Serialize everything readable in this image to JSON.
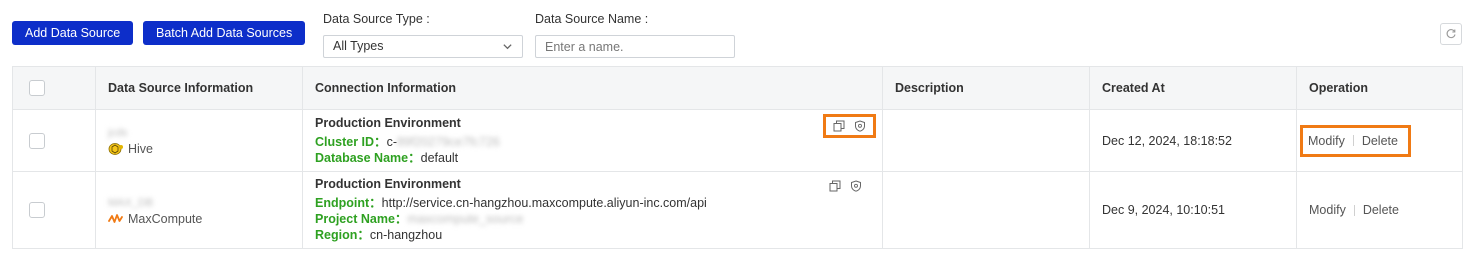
{
  "toolbar": {
    "add_label": "Add Data Source",
    "batch_add_label": "Batch Add Data Sources",
    "type_filter_label": "Data Source Type :",
    "type_filter_value": "All Types",
    "name_filter_label": "Data Source Name :",
    "name_filter_placeholder": "Enter a name."
  },
  "table": {
    "headers": {
      "info": "Data Source Information",
      "connection": "Connection Information",
      "description": "Description",
      "created": "Created At",
      "operation": "Operation"
    },
    "rows": [
      {
        "name": "jcds",
        "type": "Hive",
        "env": "Production Environment",
        "fields": [
          {
            "key": "Cluster ID",
            "sep": "：",
            "value": "c-",
            "blurred": "89f20279ce7fc726"
          },
          {
            "key": "Database Name",
            "sep": "：",
            "value": "default",
            "blurred": ""
          }
        ],
        "description": "",
        "created": "Dec 12, 2024, 18:18:52",
        "modify": "Modify",
        "delete": "Delete"
      },
      {
        "name": "MAX_DB",
        "type": "MaxCompute",
        "env": "Production Environment",
        "fields": [
          {
            "key": "Endpoint",
            "sep": "：",
            "value": "http://service.cn-hangzhou.maxcompute.aliyun-inc.com/api",
            "blurred": ""
          },
          {
            "key": "Project Name",
            "sep": "：",
            "value": "",
            "blurred": "maxcompute_source"
          },
          {
            "key": "Region",
            "sep": "：",
            "value": "cn-hangzhou",
            "blurred": ""
          }
        ],
        "description": "",
        "created": "Dec 9, 2024, 10:10:51",
        "modify": "Modify",
        "delete": "Delete"
      }
    ]
  },
  "colors": {
    "primary": "#0d2ec9",
    "field_key": "#2ea121",
    "highlight": "#f07a14"
  },
  "icons": [
    "chevron-down-icon",
    "refresh-icon",
    "copy-icon",
    "shield-icon",
    "hive-icon",
    "maxcompute-icon"
  ]
}
